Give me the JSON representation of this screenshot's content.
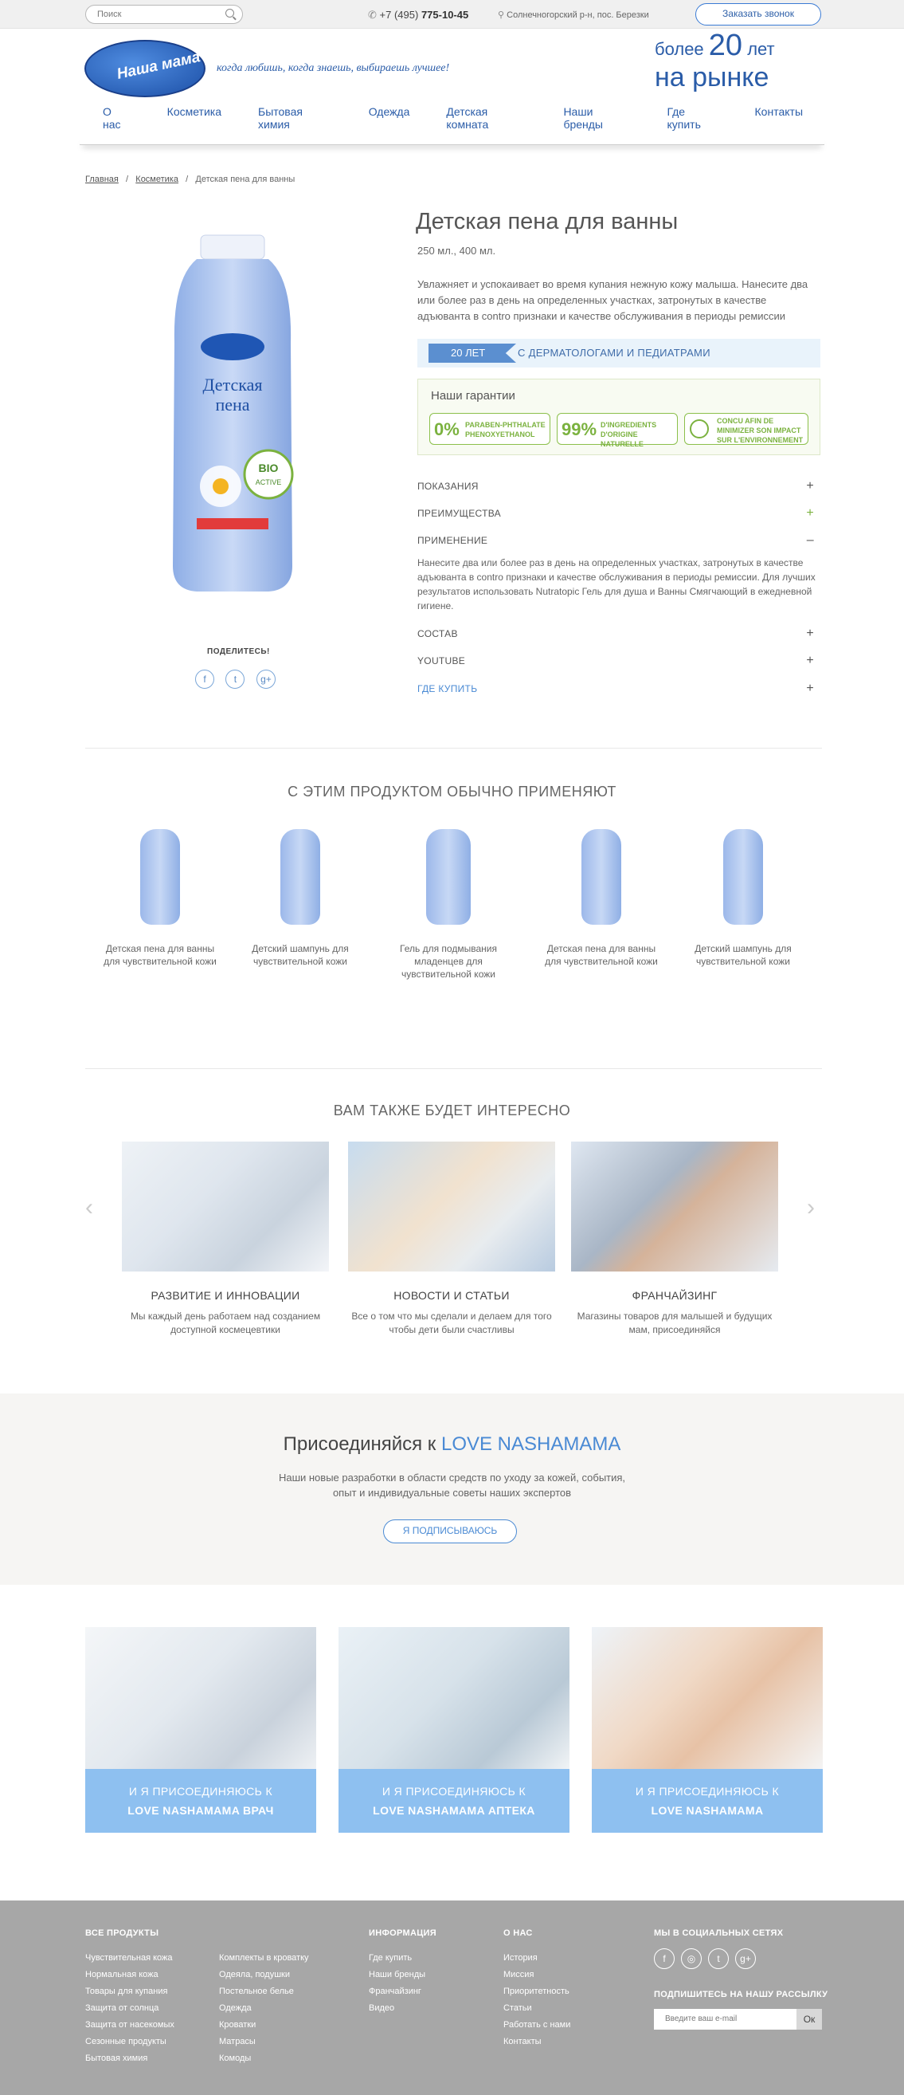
{
  "topbar": {
    "search_placeholder": "Поиск",
    "phone_prefix": "+7 (495)",
    "phone_number": "775-10-45",
    "address": "Солнечногорский р-н, пос. Березки",
    "callback": "Заказать звонок"
  },
  "header": {
    "logo_text": "Наша мама",
    "tagline": "когда любишь, когда знаешь, выбираешь лучшее!",
    "years_prefix": "более",
    "years_number": "20",
    "years_unit": "лет",
    "years_line2": "на рынке"
  },
  "nav": [
    "О нас",
    "Косметика",
    "Бытовая химия",
    "Одежда",
    "Детская комната",
    "Наши бренды",
    "Где купить",
    "Контакты"
  ],
  "breadcrumb": [
    "Главная",
    "Косметика",
    "Детская пена для ванны"
  ],
  "product": {
    "title": "Детская пена для ванны",
    "volume": "250 мл., 400 мл.",
    "description": "Увлажняет и успокаивает во время купания нежную кожу малыша. Нанесите два или более раз в день на определенных участках, затронутых в качестве адъюванта в contro признаки и качестве обслуживания в периоды ремиссии",
    "badge_tag": "20 ЛЕТ",
    "badge_text": "С ДЕРМАТОЛОГАМИ И ПЕДИАТРАМИ",
    "share": "ПОДЕЛИТЕСЬ!"
  },
  "guarantees": {
    "title": "Наши гарантии",
    "items": [
      {
        "big": "0%",
        "l1": "PARABEN-PHTHALATE",
        "l2": "PHENOXYETHANOL"
      },
      {
        "big": "99%",
        "l1": "D'INGREDIENTS",
        "l2": "D'ORIGINE NATURELLE"
      },
      {
        "big": "",
        "l1": "CONCU AFIN DE",
        "l2": "MINIMIZER SON IMPACT",
        "l3": "SUR L'ENVIRONNEMENT"
      }
    ]
  },
  "accordion": [
    {
      "label": "ПОКАЗАНИЯ",
      "sign": "+"
    },
    {
      "label": "ПРЕИМУЩЕСТВА",
      "sign": "+"
    },
    {
      "label": "ПРИМЕНЕНИЕ",
      "sign": "–"
    },
    {
      "label": "СОСТАВ",
      "sign": "+"
    },
    {
      "label": "YOUTUBE",
      "sign": "+"
    },
    {
      "label": "ГДЕ КУПИТЬ",
      "sign": "+"
    }
  ],
  "usage_text": "Нанесите два или более раз в день на определенных участках, затронутых в качестве адъюванта в contro признаки и качестве обслуживания в периоды ремиссии. Для лучших результатов использовать Nutratopic Гель для душа и Ванны Смягчающий в ежедневной гигиене.",
  "related": {
    "title": "С ЭТИМ ПРОДУКТОМ ОБЫЧНО ПРИМЕНЯЮТ",
    "items": [
      "Детская пена для ванны для чувствительной кожи",
      "Детский шампунь для чувствительной кожи",
      "Гель для подмывания младенцев для чувствительной кожи",
      "Детская пена для ванны для чувствительной кожи",
      "Детский шампунь для чувствительной кожи"
    ]
  },
  "interesting": {
    "title": "ВАМ ТАКЖЕ БУДЕТ ИНТЕРЕСНО",
    "cards": [
      {
        "title": "РАЗВИТИЕ И ИННОВАЦИИ",
        "text": "Мы каждый день работаем над созданием доступной космецевтики"
      },
      {
        "title": "НОВОСТИ И СТАТЬИ",
        "text": "Все о том что мы сделали и делаем для того чтобы дети были счастливы"
      },
      {
        "title": "ФРАНЧАЙЗИНГ",
        "text": "Магазины товаров для малышей и будущих мам, присоединяйся"
      }
    ]
  },
  "join": {
    "title_prefix": "Присоединяйся к",
    "title_brand": "LOVE NASHAMAMA",
    "text_l1": "Наши новые разработки в области средств по уходу за кожей, события,",
    "text_l2": "опыт и индивидуальные советы наших экспертов",
    "button": "Я ПОДПИСЫВАЮСЬ"
  },
  "pro": [
    {
      "l1": "И Я ПРИСОЕДИНЯЮСЬ К",
      "l2": "LOVE NASHAMAMA ВРАЧ"
    },
    {
      "l1": "И Я ПРИСОЕДИНЯЮСЬ К",
      "l2": "LOVE NASHAMAMA АПТЕКА"
    },
    {
      "l1": "И Я ПРИСОЕДИНЯЮСЬ К",
      "l2": "LOVE NASHAMAMA"
    }
  ],
  "footer": {
    "products_title": "ВСЕ ПРОДУКТЫ",
    "col1": [
      "Чувствительная кожа",
      "Нормальная кожа",
      "Товары для купания",
      "Защита от солнца",
      "Защита от насекомых",
      "Сезонные продукты",
      "Бытовая химия"
    ],
    "col2": [
      "Комплекты в кроватку",
      "Одеяла, подушки",
      "Постельное белье",
      "Одежда",
      "Кроватки",
      "Матрасы",
      "Комоды"
    ],
    "info_title": "ИНФОРМАЦИЯ",
    "col3": [
      "Где купить",
      "Наши бренды",
      "Франчайзинг",
      "Видео"
    ],
    "about_title": "О НАС",
    "col4": [
      "История",
      "Миссия",
      "Приоритетность",
      "Статьи",
      "Работать с нами",
      "Контакты"
    ],
    "social_title": "МЫ В СОЦИАЛЬНЫХ СЕТЯХ",
    "newsletter_title": "ПОДПИШИТЕСЬ НА НАШУ РАССЫЛКУ",
    "email_placeholder": "Введите ваш e-mail",
    "ok": "Ок"
  },
  "colors": {
    "brand": "#2a5ca8",
    "accent": "#4a8ad4",
    "green": "#7bb23f",
    "footer": "#a7a7a7",
    "pro_label": "#8ec0f0"
  }
}
